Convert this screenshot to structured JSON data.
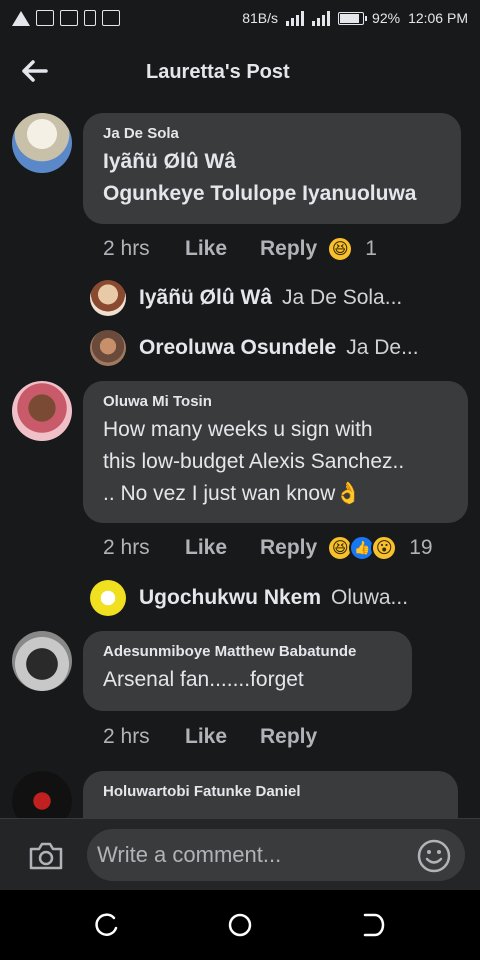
{
  "status_bar": {
    "net_speed": "81B/s",
    "battery": "92%",
    "time": "12:06 PM"
  },
  "header": {
    "title": "Lauretta's Post",
    "back_icon": "arrow-left-icon"
  },
  "comments": [
    {
      "author": "Ja De Sola",
      "lines": [
        "Iyãñü Ølû Wâ",
        "Ogunkeye Tolulope Iyanuoluwa"
      ],
      "time": "2 hrs",
      "like": "Like",
      "reply": "Reply",
      "reactions": [
        "haha"
      ],
      "reaction_count": "1",
      "replies": [
        {
          "name": "Iyãñü Ølû Wâ",
          "snippet": "Ja De Sola..."
        },
        {
          "name": "Oreoluwa Osundele",
          "snippet": "Ja De..."
        }
      ]
    },
    {
      "author": "Oluwa Mi Tosin",
      "lines": [
        "How many weeks u sign with",
        "this low-budget Alexis Sanchez..",
        ".. No vez I just wan know👌"
      ],
      "time": "2 hrs",
      "like": "Like",
      "reply": "Reply",
      "reactions": [
        "haha",
        "like",
        "wow"
      ],
      "reaction_count": "19",
      "replies": [
        {
          "name": "Ugochukwu Nkem",
          "snippet": "Oluwa..."
        }
      ]
    },
    {
      "author": "Adesunmiboye Matthew Babatunde",
      "lines": [
        "Arsenal fan.......forget"
      ],
      "time": "2 hrs",
      "like": "Like",
      "reply": "Reply"
    },
    {
      "author": "Holuwartobi Fatunke Daniel"
    }
  ],
  "composer": {
    "placeholder": "Write a comment..."
  }
}
